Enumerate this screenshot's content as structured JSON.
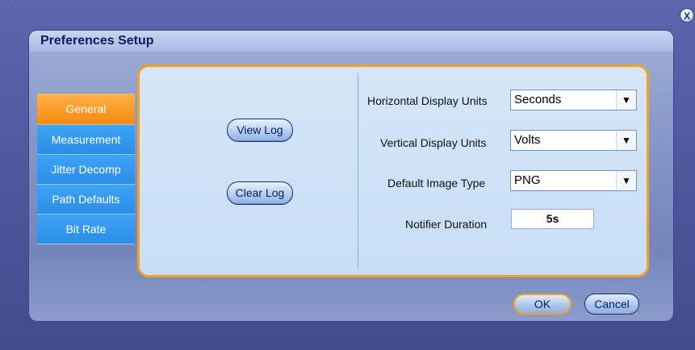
{
  "window": {
    "close_label": "X",
    "grip_glyph": "⋰"
  },
  "dialog": {
    "title": "Preferences Setup"
  },
  "tabs": [
    {
      "label": "General",
      "active": true
    },
    {
      "label": "Measurement",
      "active": false
    },
    {
      "label": "Jitter Decomp",
      "active": false
    },
    {
      "label": "Path Defaults",
      "active": false
    },
    {
      "label": "Bit Rate",
      "active": false
    }
  ],
  "log": {
    "view_label": "View Log",
    "clear_label": "Clear Log"
  },
  "settings": {
    "horizontal": {
      "label": "Horizontal Display Units",
      "value": "Seconds"
    },
    "vertical": {
      "label": "Vertical Display Units",
      "value": "Volts"
    },
    "image_type": {
      "label": "Default Image Type",
      "value": "PNG"
    },
    "notifier": {
      "label": "Notifier Duration",
      "value": "5s"
    },
    "dropdown_arrow": "▼"
  },
  "footer": {
    "ok_label": "OK",
    "cancel_label": "Cancel"
  },
  "colors": {
    "active_tab": "#f58a0e",
    "inactive_tab": "#2a8de8",
    "panel_border": "#f5a020",
    "title_text": "#0d1b5c"
  }
}
